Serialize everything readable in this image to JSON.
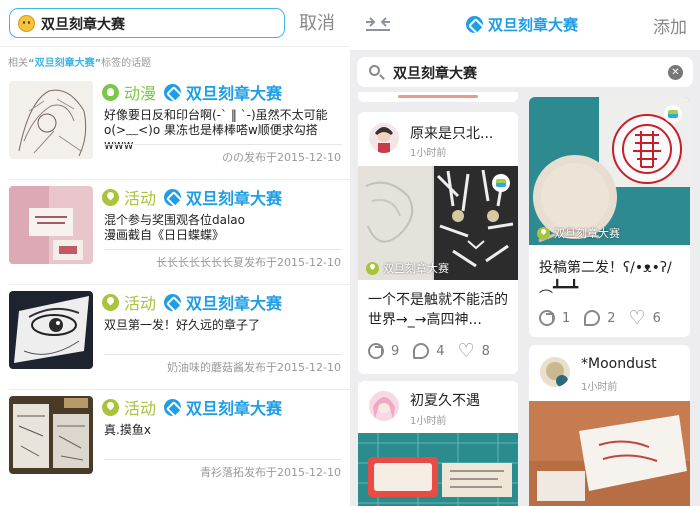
{
  "left": {
    "search_value": "双旦刻章大赛",
    "cancel_label": "取消",
    "hint_prefix": "相关",
    "hint_tag": "“双旦刻章大赛”",
    "hint_suffix": "标签的话题",
    "items": [
      {
        "category": "动漫",
        "category_icon": "palette-icon",
        "tag": "双旦刻章大赛",
        "desc": "好像要日反和印台啊(-` ‖ `-)虽然不太可能o(>﹏<)o 果冻也是棒棒嗒w顺便求勾搭www",
        "meta": "のの发布于2015-12-10"
      },
      {
        "category": "活动",
        "category_icon": "location-icon",
        "tag": "双旦刻章大赛",
        "desc": "混个参与奖围观各位dalao\n漫画截自《日日蝶蝶》",
        "meta": "长长长长长长长夏发布于2015-12-10"
      },
      {
        "category": "活动",
        "category_icon": "location-icon",
        "tag": "双旦刻章大赛",
        "desc": "双旦第一发！好久远的章子了",
        "meta": "奶油味的蘑菇酱发布于2015-12-10"
      },
      {
        "category": "活动",
        "category_icon": "location-icon",
        "tag": "双旦刻章大赛",
        "desc": "真.摸鱼x",
        "meta": "青衫落拓发布于2015-12-10"
      }
    ]
  },
  "right": {
    "title": "双旦刻章大赛",
    "add_label": "添加",
    "search_value": "双旦刻章大赛",
    "clear_label": "✕",
    "cards": [
      {
        "user": "原来是只北...",
        "time": "1小时前",
        "img_tag": "双旦刻章大赛",
        "text": "一个不是触就不能活的世界→_→高四神...",
        "shares": "9",
        "comments": "4",
        "likes": "8"
      },
      {
        "img_tag": "双旦刻章大赛",
        "text": "投稿第二发！ʕ/•ᴥ•ʔ/︵┻━┻",
        "shares": "1",
        "comments": "2",
        "likes": "6"
      },
      {
        "user": "初夏久不遇",
        "time": "1小时前"
      },
      {
        "user": "*Moondust",
        "time": "1小时前"
      }
    ]
  }
}
